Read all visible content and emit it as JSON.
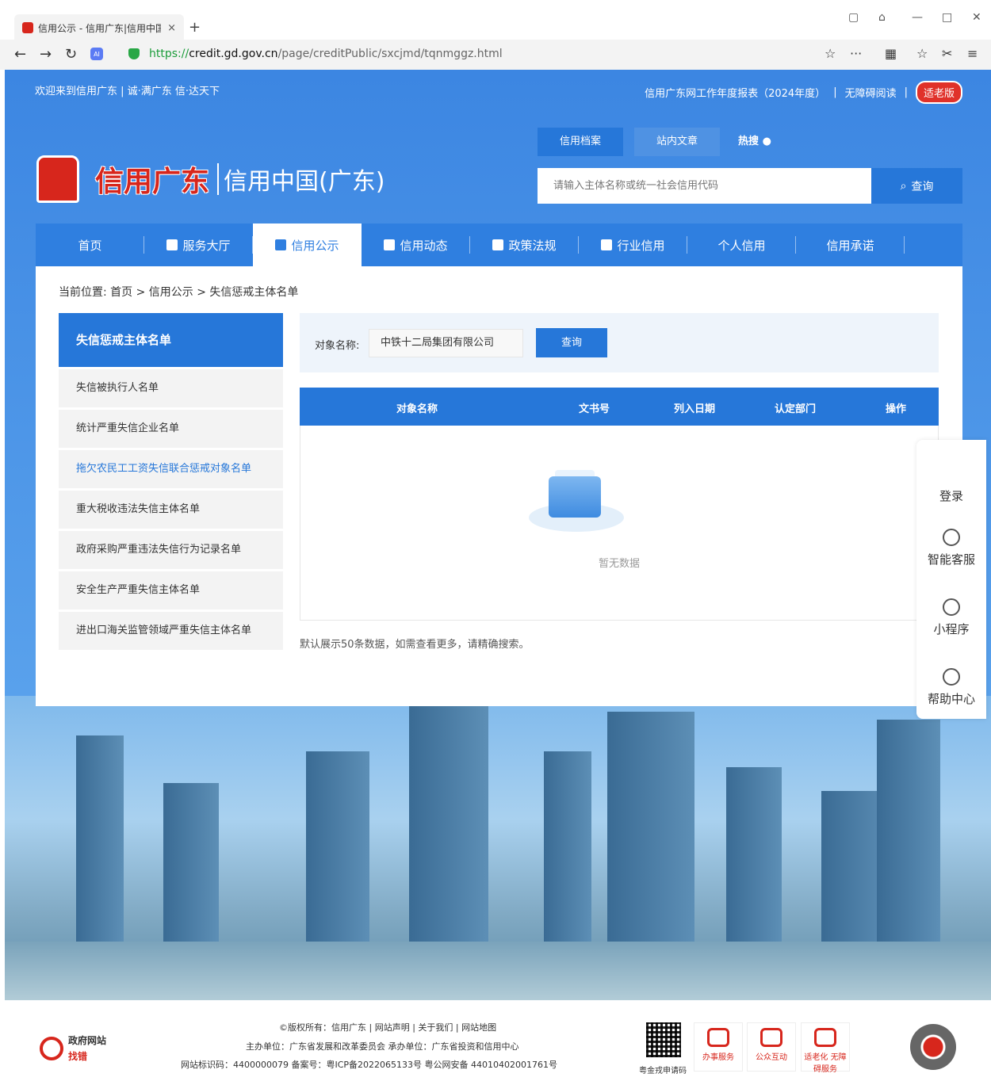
{
  "browser": {
    "tab_title": "信用公示 - 信用广东|信用中国",
    "tab_close": "×",
    "new_tab": "+",
    "url_proto": "https://",
    "url_host": "credit.gd.gov.cn",
    "url_path": "/page/creditPublic/sxcjmd/tqnmggz.html"
  },
  "topstrip": {
    "welcome": "欢迎来到信用广东 | 诚·满广东 信·达天下",
    "report": "信用广东网工作年度报表（2024年度）",
    "sep1": "|",
    "accessible": "无障碍阅读",
    "sep2": "|",
    "elder": "适老版"
  },
  "logo": {
    "name": "信用广东",
    "sub": "信用中国(广东)"
  },
  "search": {
    "tabs": [
      "信用档案",
      "站内文章"
    ],
    "hot": "热搜",
    "placeholder": "请输入主体名称或统一社会信用代码",
    "button": "查询"
  },
  "nav": [
    "首页",
    "服务大厅",
    "信用公示",
    "信用动态",
    "政策法规",
    "行业信用",
    "个人信用",
    "信用承诺"
  ],
  "breadcrumb": "当前位置:  首页 > 信用公示 > 失信惩戒主体名单",
  "sidebar": {
    "title": "失信惩戒主体名单",
    "items": [
      "失信被执行人名单",
      "统计严重失信企业名单",
      "拖欠农民工工资失信联合惩戒对象名单",
      "重大税收违法失信主体名单",
      "政府采购严重违法失信行为记录名单",
      "安全生产严重失信主体名单",
      "进出口海关监管领域严重失信主体名单"
    ]
  },
  "filter": {
    "label": "对象名称:",
    "value": "中铁十二局集团有限公司",
    "button": "查询"
  },
  "table": {
    "headers": [
      "对象名称",
      "文书号",
      "列入日期",
      "认定部门",
      "操作"
    ],
    "empty": "暂无数据",
    "note": "默认展示50条数据，如需查看更多，请精确搜索。"
  },
  "floatbar": {
    "login": "登录",
    "service": "智能客服",
    "miniapp": "小程序",
    "help": "帮助中心"
  },
  "footer": {
    "gov_line1": "政府网站",
    "gov_line2": "找错",
    "line1": "©版权所有：信用广东 | 网站声明 | 关于我们 | 网站地图",
    "line2": "主办单位：广东省发展和改革委员会     承办单位：广东省投资和信用中心",
    "line3": "网站标识码：4400000079     备案号：粤ICP备2022065133号     粤公网安备 44010402001761号",
    "qr_caption": "粤金戎申请码",
    "svc1": "办事服务",
    "svc2": "公众互动",
    "svc3": "适老化 无障碍服务"
  },
  "colors": {
    "primary": "#2677d9",
    "brand_red": "#d7261c"
  }
}
